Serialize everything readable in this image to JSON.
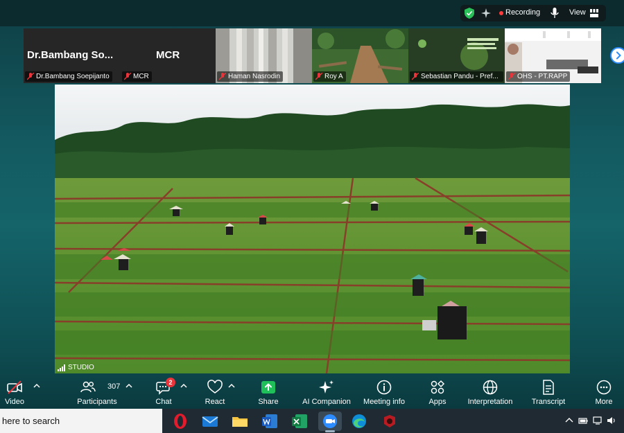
{
  "top_bar": {
    "recording_label": "Recording",
    "view_label": "View"
  },
  "participants_strip": [
    {
      "display_name": "Dr.Bambang  So...",
      "label": "Dr.Bambang Soepijanto",
      "muted": true
    },
    {
      "display_name": "MCR",
      "label": "MCR",
      "muted": true
    },
    {
      "label": "Haman Nasrodin",
      "muted": true
    },
    {
      "label": "Roy A",
      "muted": true
    },
    {
      "label": "Sebastian Pandu - Pref...",
      "muted": true
    },
    {
      "label": "OHS - PT.RAPP",
      "muted": true
    }
  ],
  "main_video": {
    "quality_label": "STUDIO"
  },
  "toolbar": {
    "video_label": "Video",
    "participants_label": "Participants",
    "participants_count": "307",
    "chat_label": "Chat",
    "chat_badge": "2",
    "react_label": "React",
    "share_label": "Share",
    "ai_companion_label": "AI Companion",
    "meeting_info_label": "Meeting info",
    "apps_label": "Apps",
    "interpretation_label": "Interpretation",
    "transcript_label": "Transcript",
    "more_label": "More"
  },
  "taskbar": {
    "search_text": "here to search",
    "apps": [
      "opera-icon",
      "mail-icon",
      "file-explorer-icon",
      "word-icon",
      "excel-icon",
      "zoom-icon",
      "edge-icon",
      "game-app-icon"
    ]
  },
  "colors": {
    "share_green": "#1fbf5a",
    "recording_red": "#ff3b3b",
    "chat_badge_red": "#e8343a",
    "zoom_blue": "#2d8cff"
  }
}
